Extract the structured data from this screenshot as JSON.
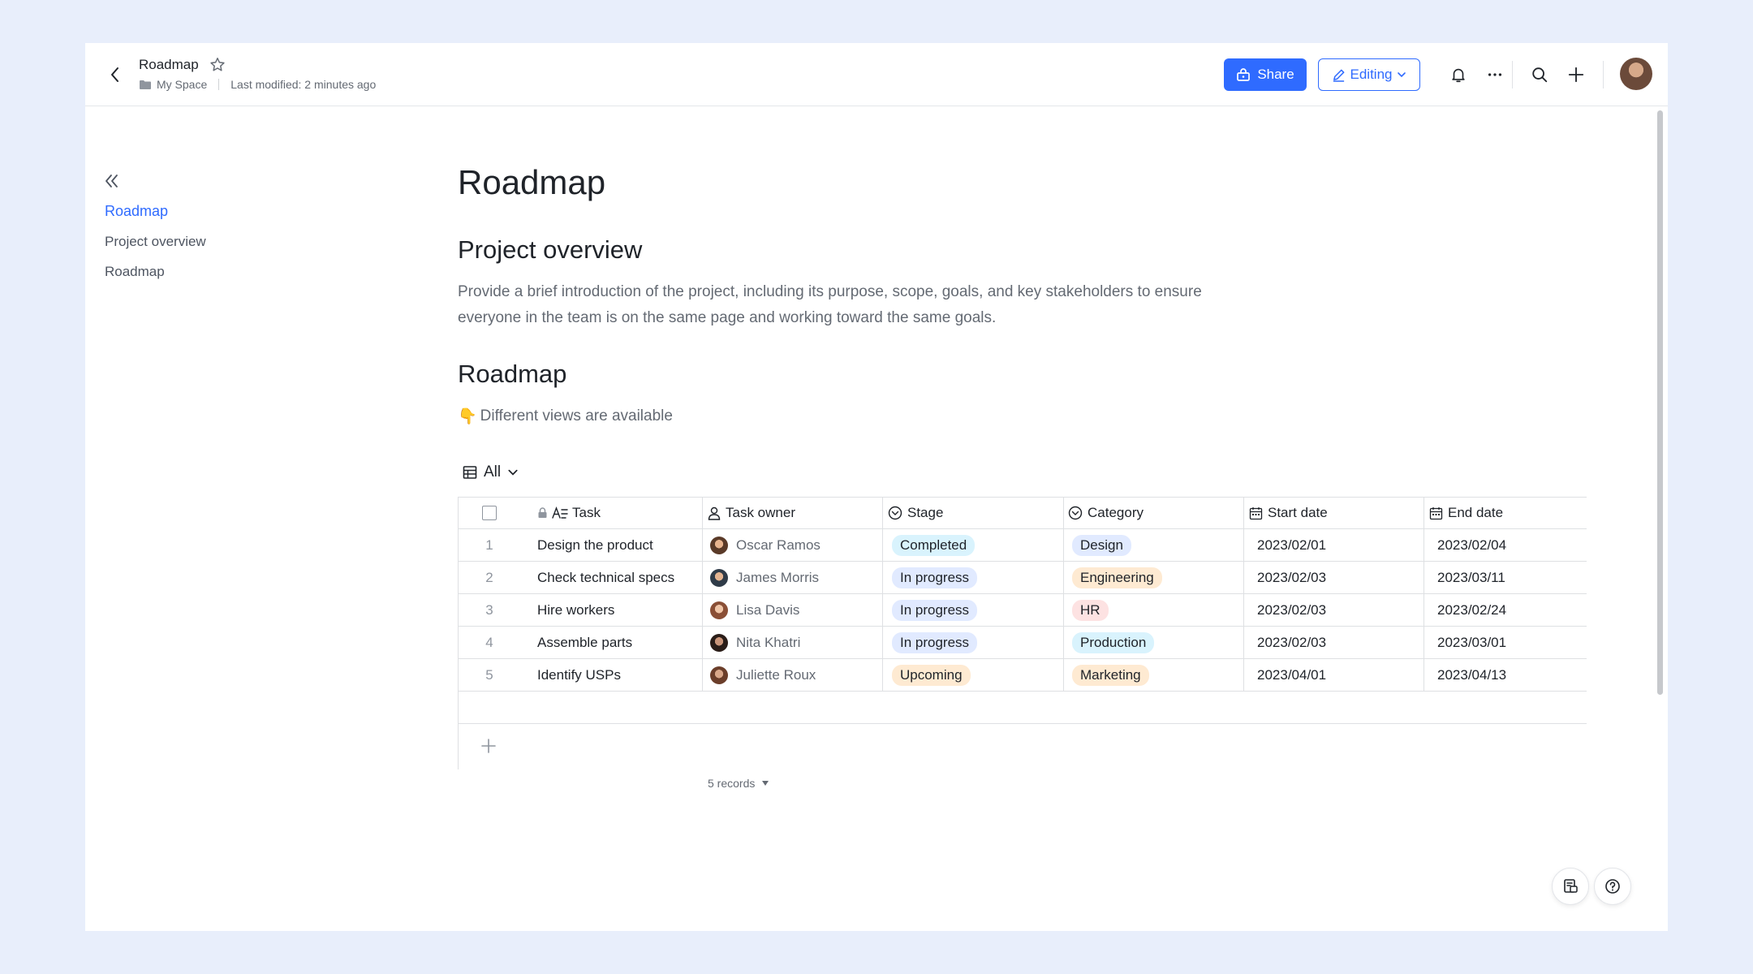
{
  "header": {
    "title": "Roadmap",
    "folder": "My Space",
    "last_modified": "Last modified: 2 minutes ago",
    "share_label": "Share",
    "editing_label": "Editing"
  },
  "outline": {
    "items": [
      {
        "label": "Roadmap",
        "active": true
      },
      {
        "label": "Project overview",
        "active": false
      },
      {
        "label": "Roadmap",
        "active": false
      }
    ]
  },
  "doc": {
    "title": "Roadmap",
    "section1_heading": "Project overview",
    "section1_body": "Provide a brief introduction of the project, including its purpose, scope, goals, and key stakeholders to ensure everyone in the team is on the same page and working toward the same goals.",
    "section2_heading": "Roadmap",
    "hint_emoji": "👇",
    "hint_text": "Different views are available"
  },
  "table": {
    "view_label": "All",
    "columns": [
      "Task",
      "Task owner",
      "Stage",
      "Category",
      "Start date",
      "End date"
    ],
    "rows": [
      {
        "num": "1",
        "task": "Design the product",
        "owner": "Oscar Ramos",
        "stage": "Completed",
        "category": "Design",
        "start": "2023/02/01",
        "end": "2023/02/04"
      },
      {
        "num": "2",
        "task": "Check technical specs",
        "owner": "James Morris",
        "stage": "In progress",
        "category": "Engineering",
        "start": "2023/02/03",
        "end": "2023/03/11"
      },
      {
        "num": "3",
        "task": "Hire workers",
        "owner": "Lisa Davis",
        "stage": "In progress",
        "category": "HR",
        "start": "2023/02/03",
        "end": "2023/02/24"
      },
      {
        "num": "4",
        "task": "Assemble parts",
        "owner": "Nita Khatri",
        "stage": "In progress",
        "category": "Production",
        "start": "2023/02/03",
        "end": "2023/03/01"
      },
      {
        "num": "5",
        "task": "Identify USPs",
        "owner": "Juliette Roux",
        "stage": "Upcoming",
        "category": "Marketing",
        "start": "2023/04/01",
        "end": "2023/04/13"
      }
    ],
    "records_label": "5 records"
  },
  "colors": {
    "accent": "#2f6bff",
    "tag_completed": "#d9f3fd",
    "tag_in_progress": "#e1eaff",
    "tag_upcoming": "#feead2",
    "tag_design": "#e1eaff",
    "tag_engineering": "#feead2",
    "tag_hr": "#fde2e2",
    "tag_production": "#d9f3fd",
    "tag_marketing": "#feead2"
  }
}
